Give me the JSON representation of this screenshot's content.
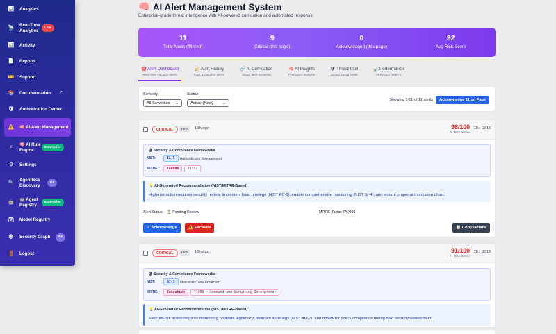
{
  "sidebar": {
    "items": [
      {
        "label": "Analytics",
        "icon": "📊"
      },
      {
        "label": "Real-Time Analytics",
        "icon": "📡",
        "badge": "Live"
      },
      {
        "label": "Activity",
        "icon": "📊"
      },
      {
        "label": "Reports",
        "icon": "📄"
      },
      {
        "label": "Support",
        "icon": "🎫"
      },
      {
        "label": "Documentation",
        "icon": "📚",
        "ext": "↗"
      },
      {
        "label": "Authorization Center",
        "icon": "🛡"
      },
      {
        "label": "🧠 AI Alert Management",
        "icon": "⚠️"
      },
      {
        "label": "🧠 AI Rule Engine",
        "icon": "⚡",
        "badge": "Enterprise"
      },
      {
        "label": "Settings",
        "icon": "⚙"
      },
      {
        "label": "Agentless Discovery",
        "icon": "🔍",
        "badge": "P1"
      },
      {
        "label": "🤖 Agent Registry",
        "icon": "🤖",
        "badge": "Enterprise"
      },
      {
        "label": "Model Registry",
        "icon": "🗃"
      },
      {
        "label": "Security Graph",
        "icon": "🕸",
        "badge": "P2"
      },
      {
        "label": "Logout",
        "icon": "🚪"
      }
    ]
  },
  "header": {
    "icon": "🧠",
    "title": "AI Alert Management System",
    "subtitle": "Enterprise-grade threat intelligence with AI-powered correlation and automated response"
  },
  "stats": [
    {
      "value": "11",
      "label": "Total Alerts (filtered)"
    },
    {
      "value": "9",
      "label": "Critical (this page)"
    },
    {
      "value": "0",
      "label": "Acknowledged (this page)"
    },
    {
      "value": "92",
      "label": "Avg Risk Score"
    }
  ],
  "tabs": [
    {
      "label": "🎯 Alert Dashboard",
      "sub": "Real-time security alerts"
    },
    {
      "label": "📜 Alert History",
      "sub": "Past & handled alerts"
    },
    {
      "label": "🔗 AI Correlation",
      "sub": "Smart alert grouping"
    },
    {
      "label": "🧠 AI Insights",
      "sub": "Predictive analysis"
    },
    {
      "label": "🛡 Threat Intel",
      "sub": "Global threat feeds"
    },
    {
      "label": "📊 Performance",
      "sub": "AI system metrics"
    }
  ],
  "filters": {
    "severity_label": "Severity",
    "severity_value": "All Severities",
    "status_label": "Status",
    "status_value": "Active (New)",
    "showing": "Showing 1-11 of 11 alerts",
    "ack_all": "Acknowledge 11 on Page"
  },
  "alerts": [
    {
      "severity": "CRITICAL",
      "status": "new",
      "ago": "16h ago",
      "score": "98/100",
      "score_label": "AI Risk Score",
      "id": "ID: 2016",
      "frameworks_title": "🛡 Security & Compliance Frameworks",
      "nist_key": "NIST:",
      "nist_code": "IA-5",
      "nist_desc": "Authenticator Management",
      "mitre_key": "MITRE:",
      "mitre_tactic": "TA0006",
      "mitre_tech": "T1552",
      "ai_title": "💡 AI-Generated Recommendation (NIST/MITRE-Based)",
      "ai_text": "High-risk action requires security review. Implement least privilege (NIST AC-6), enable comprehensive monitoring (NIST SI-4), and ensure proper authorization chain.",
      "alert_status_label": "Alert Status:",
      "alert_status_value": "⏳ Pending Review",
      "mitre_tactic_label": "MITRE Tactic: TA0006",
      "btn_ack": "✓ Acknowledge",
      "btn_esc": "⚠️ Escalate",
      "btn_copy": "📋 Copy Details"
    },
    {
      "severity": "CRITICAL",
      "status": "new",
      "ago": "16h ago",
      "score": "91/100",
      "score_label": "AI Risk Score",
      "id": "ID: 2013",
      "frameworks_title": "🛡 Security & Compliance Frameworks",
      "nist_key": "NIST:",
      "nist_code": "SI-3",
      "nist_desc": "Malicious Code Protection",
      "mitre_key": "MITRE:",
      "mitre_tactic": "Execution",
      "mitre_tech": "T1059 - Command and Scripting Interpreter",
      "ai_title": "💡 AI-Generated Recommendation (NIST/MITRE-Based)",
      "ai_text": "Medium-risk action requires monitoring. Validate legitimacy, maintain audit logs (NIST AU-2), and review for policy compliance during next security assessment."
    }
  ]
}
